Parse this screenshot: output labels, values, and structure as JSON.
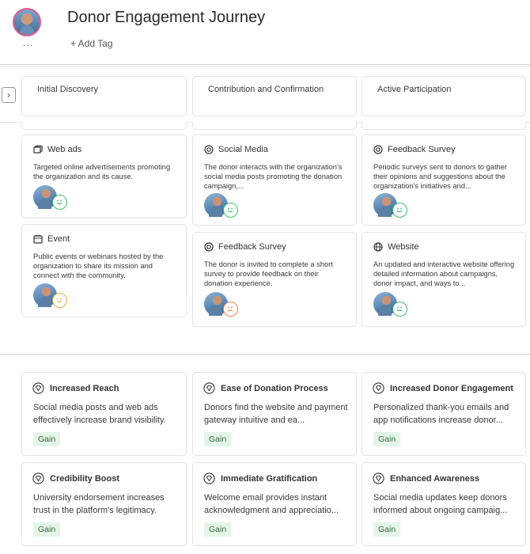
{
  "header": {
    "title": "Donor Engagement Journey",
    "add_tag_label": "+ Add Tag",
    "more_label": "..."
  },
  "stages": [
    {
      "label": "Initial Discovery"
    },
    {
      "label": "Contribution and Confirmation"
    },
    {
      "label": "Active Participation"
    }
  ],
  "touchpoints": [
    {
      "stage": "Initial Discovery",
      "icon": "ad-window-icon",
      "title": "Web ads",
      "description": "Targeted online advertisements promoting the organization and its cause.",
      "emotion": "happy"
    },
    {
      "stage": "Initial Discovery",
      "icon": "calendar-icon",
      "title": "Event",
      "description": "Public events or webinars hosted by the organization to share its mission and connect with the community.",
      "emotion": "neutral"
    },
    {
      "stage": "Contribution and Confirmation",
      "icon": "target-icon",
      "title": "Social Media",
      "description": "The donor interacts with the organization's social media posts promoting the donation campaign,...",
      "emotion": "happy"
    },
    {
      "stage": "Contribution and Confirmation",
      "icon": "target-icon",
      "title": "Feedback Survey",
      "description": "The donor is invited to complete a short survey to provide feedback on their donation experience.",
      "emotion": "sad"
    },
    {
      "stage": "Active Participation",
      "icon": "target-icon",
      "title": "Feedback Survey",
      "description": "Periodic surveys sent to donors to gather their opinions and suggestions about the organization's initiatives and...",
      "emotion": "happy"
    },
    {
      "stage": "Active Participation",
      "icon": "globe-icon",
      "title": "Website",
      "description": "An updated and interactive website offering detailed information about campaigns, donor impact, and ways to...",
      "emotion": "happy"
    }
  ],
  "insights": [
    {
      "title": "Increased Reach",
      "description": "Social media posts and web ads effectively increase brand visibility.",
      "badge": "Gain"
    },
    {
      "title": "Ease of Donation Process",
      "description": "Donors find the website and payment gateway intuitive and ea...",
      "badge": "Gain"
    },
    {
      "title": "Increased Donor Engagement",
      "description": "Personalized thank-you emails and app notifications increase donor...",
      "badge": "Gain"
    },
    {
      "title": "Credibility Boost",
      "description": "University endorsement increases trust in the platform's legitimacy.",
      "badge": "Gain"
    },
    {
      "title": "Immediate Gratification",
      "description": "Welcome email provides instant acknowledgment and appreciatio...",
      "badge": "Gain"
    },
    {
      "title": "Enhanced Awareness",
      "description": "Social media updates keep donors informed about ongoing campaig...",
      "badge": "Gain"
    }
  ],
  "colors": {
    "emotion_happy": "#3fbf6a",
    "emotion_neutral": "#e6b13a",
    "emotion_sad": "#e8844a",
    "gain_badge_bg": "#e3f5e7",
    "avatar_border": "#e5588c"
  }
}
